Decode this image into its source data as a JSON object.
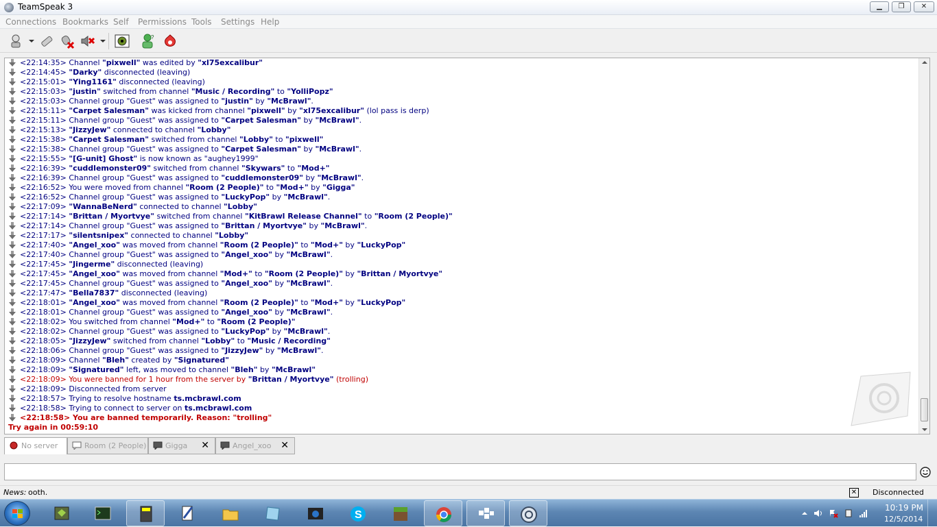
{
  "window": {
    "title": "TeamSpeak 3",
    "min": "▁",
    "max": "❐",
    "close": "✕"
  },
  "menu": [
    "Connections",
    "Bookmarks",
    "Self",
    "Permissions",
    "Tools",
    "Settings",
    "Help"
  ],
  "toolbar": {
    "icons": [
      "connect-icon",
      "disconnect-icon",
      "mute-microphone-icon",
      "mute-speakers-icon",
      "away-icon",
      "activate-microphone-icon",
      "subscribe-icon"
    ]
  },
  "log": [
    {
      "time": "<22:14:35>",
      "parts": [
        [
          "n",
          "Channel "
        ],
        [
          "b",
          "\"pixwell\""
        ],
        [
          "n",
          " was edited by "
        ],
        [
          "b",
          "\"xl75excalibur\""
        ]
      ]
    },
    {
      "time": "<22:14:45>",
      "parts": [
        [
          "b",
          "\"Darky\""
        ],
        [
          "n",
          " disconnected (leaving)"
        ]
      ]
    },
    {
      "time": "<22:15:01>",
      "parts": [
        [
          "b",
          "\"Ying1161\""
        ],
        [
          "n",
          " disconnected (leaving)"
        ]
      ]
    },
    {
      "time": "<22:15:03>",
      "parts": [
        [
          "b",
          "\"justin\""
        ],
        [
          "n",
          " switched from channel "
        ],
        [
          "b",
          "\"Music / Recording\""
        ],
        [
          "n",
          " to "
        ],
        [
          "b",
          "\"YolliPopz\""
        ]
      ]
    },
    {
      "time": "<22:15:03>",
      "parts": [
        [
          "n",
          "Channel group \"Guest\" was assigned to "
        ],
        [
          "b",
          "\"justin\""
        ],
        [
          "n",
          " by "
        ],
        [
          "b",
          "\"McBrawl\""
        ],
        [
          "n",
          "."
        ]
      ]
    },
    {
      "time": "<22:15:11>",
      "parts": [
        [
          "b",
          "\"Carpet Salesman\""
        ],
        [
          "n",
          " was kicked from channel "
        ],
        [
          "b",
          "\"pixwell\""
        ],
        [
          "n",
          " by "
        ],
        [
          "b",
          "\"xl75excalibur\""
        ],
        [
          "n",
          " (lol pass is derp)"
        ]
      ]
    },
    {
      "time": "<22:15:11>",
      "parts": [
        [
          "n",
          "Channel group \"Guest\" was assigned to "
        ],
        [
          "b",
          "\"Carpet Salesman\""
        ],
        [
          "n",
          " by "
        ],
        [
          "b",
          "\"McBrawl\""
        ],
        [
          "n",
          "."
        ]
      ]
    },
    {
      "time": "<22:15:13>",
      "parts": [
        [
          "b",
          "\"JizzyJew\""
        ],
        [
          "n",
          " connected to channel "
        ],
        [
          "b",
          "\"Lobby\""
        ]
      ]
    },
    {
      "time": "<22:15:38>",
      "parts": [
        [
          "b",
          "\"Carpet Salesman\""
        ],
        [
          "n",
          " switched from channel "
        ],
        [
          "b",
          "\"Lobby\""
        ],
        [
          "n",
          " to "
        ],
        [
          "b",
          "\"pixwell\""
        ]
      ]
    },
    {
      "time": "<22:15:38>",
      "parts": [
        [
          "n",
          "Channel group \"Guest\" was assigned to "
        ],
        [
          "b",
          "\"Carpet Salesman\""
        ],
        [
          "n",
          " by "
        ],
        [
          "b",
          "\"McBrawl\""
        ],
        [
          "n",
          "."
        ]
      ]
    },
    {
      "time": "<22:15:55>",
      "parts": [
        [
          "b",
          "\"[G-unit] Ghost\""
        ],
        [
          "n",
          " is now known as \"aughey1999\""
        ]
      ]
    },
    {
      "time": "<22:16:39>",
      "parts": [
        [
          "b",
          "\"cuddlemonster09\""
        ],
        [
          "n",
          " switched from channel "
        ],
        [
          "b",
          "\"Skywars\""
        ],
        [
          "n",
          " to "
        ],
        [
          "b",
          "\"Mod+\""
        ]
      ]
    },
    {
      "time": "<22:16:39>",
      "parts": [
        [
          "n",
          "Channel group \"Guest\" was assigned to "
        ],
        [
          "b",
          "\"cuddlemonster09\""
        ],
        [
          "n",
          " by "
        ],
        [
          "b",
          "\"McBrawl\""
        ],
        [
          "n",
          "."
        ]
      ]
    },
    {
      "time": "<22:16:52>",
      "parts": [
        [
          "n",
          "You were moved from channel "
        ],
        [
          "b",
          "\"Room (2 People)\""
        ],
        [
          "n",
          " to "
        ],
        [
          "b",
          "\"Mod+\""
        ],
        [
          "n",
          " by "
        ],
        [
          "b",
          "\"Gigga\""
        ]
      ]
    },
    {
      "time": "<22:16:52>",
      "parts": [
        [
          "n",
          "Channel group \"Guest\" was assigned to "
        ],
        [
          "b",
          "\"LuckyPop\""
        ],
        [
          "n",
          " by "
        ],
        [
          "b",
          "\"McBrawl\""
        ],
        [
          "n",
          "."
        ]
      ]
    },
    {
      "time": "<22:17:09>",
      "parts": [
        [
          "b",
          "\"WannaBeNerd\""
        ],
        [
          "n",
          " connected to channel "
        ],
        [
          "b",
          "\"Lobby\""
        ]
      ]
    },
    {
      "time": "<22:17:14>",
      "parts": [
        [
          "b",
          "\"Brittan / Myortvye\""
        ],
        [
          "n",
          " switched from channel "
        ],
        [
          "b",
          "\"KitBrawl Release Channel\""
        ],
        [
          "n",
          " to "
        ],
        [
          "b",
          "\"Room (2 People)\""
        ]
      ]
    },
    {
      "time": "<22:17:14>",
      "parts": [
        [
          "n",
          "Channel group \"Guest\" was assigned to "
        ],
        [
          "b",
          "\"Brittan / Myortvye\""
        ],
        [
          "n",
          " by "
        ],
        [
          "b",
          "\"McBrawl\""
        ],
        [
          "n",
          "."
        ]
      ]
    },
    {
      "time": "<22:17:17>",
      "parts": [
        [
          "b",
          "\"silentsnipex\""
        ],
        [
          "n",
          " connected to channel "
        ],
        [
          "b",
          "\"Lobby\""
        ]
      ]
    },
    {
      "time": "<22:17:40>",
      "parts": [
        [
          "b",
          "\"Angel_xoo\""
        ],
        [
          "n",
          " was moved from channel "
        ],
        [
          "b",
          "\"Room (2 People)\""
        ],
        [
          "n",
          " to "
        ],
        [
          "b",
          "\"Mod+\""
        ],
        [
          "n",
          " by "
        ],
        [
          "b",
          "\"LuckyPop\""
        ]
      ]
    },
    {
      "time": "<22:17:40>",
      "parts": [
        [
          "n",
          "Channel group \"Guest\" was assigned to "
        ],
        [
          "b",
          "\"Angel_xoo\""
        ],
        [
          "n",
          " by "
        ],
        [
          "b",
          "\"McBrawl\""
        ],
        [
          "n",
          "."
        ]
      ]
    },
    {
      "time": "<22:17:45>",
      "parts": [
        [
          "b",
          "\"Jingerme\""
        ],
        [
          "n",
          " disconnected (leaving)"
        ]
      ]
    },
    {
      "time": "<22:17:45>",
      "parts": [
        [
          "b",
          "\"Angel_xoo\""
        ],
        [
          "n",
          " was moved from channel "
        ],
        [
          "b",
          "\"Mod+\""
        ],
        [
          "n",
          " to "
        ],
        [
          "b",
          "\"Room (2 People)\""
        ],
        [
          "n",
          " by "
        ],
        [
          "b",
          "\"Brittan / Myortvye\""
        ]
      ]
    },
    {
      "time": "<22:17:45>",
      "parts": [
        [
          "n",
          "Channel group \"Guest\" was assigned to "
        ],
        [
          "b",
          "\"Angel_xoo\""
        ],
        [
          "n",
          " by "
        ],
        [
          "b",
          "\"McBrawl\""
        ],
        [
          "n",
          "."
        ]
      ]
    },
    {
      "time": "<22:17:47>",
      "parts": [
        [
          "b",
          "\"Bella7837\""
        ],
        [
          "n",
          " disconnected (leaving)"
        ]
      ]
    },
    {
      "time": "<22:18:01>",
      "parts": [
        [
          "b",
          "\"Angel_xoo\""
        ],
        [
          "n",
          " was moved from channel "
        ],
        [
          "b",
          "\"Room (2 People)\""
        ],
        [
          "n",
          " to "
        ],
        [
          "b",
          "\"Mod+\""
        ],
        [
          "n",
          " by "
        ],
        [
          "b",
          "\"LuckyPop\""
        ]
      ]
    },
    {
      "time": "<22:18:01>",
      "parts": [
        [
          "n",
          "Channel group \"Guest\" was assigned to "
        ],
        [
          "b",
          "\"Angel_xoo\""
        ],
        [
          "n",
          " by "
        ],
        [
          "b",
          "\"McBrawl\""
        ],
        [
          "n",
          "."
        ]
      ]
    },
    {
      "time": "<22:18:02>",
      "parts": [
        [
          "n",
          "You switched from channel "
        ],
        [
          "b",
          "\"Mod+\""
        ],
        [
          "n",
          " to "
        ],
        [
          "b",
          "\"Room (2 People)\""
        ]
      ]
    },
    {
      "time": "<22:18:02>",
      "parts": [
        [
          "n",
          "Channel group \"Guest\" was assigned to "
        ],
        [
          "b",
          "\"LuckyPop\""
        ],
        [
          "n",
          " by "
        ],
        [
          "b",
          "\"McBrawl\""
        ],
        [
          "n",
          "."
        ]
      ]
    },
    {
      "time": "<22:18:05>",
      "parts": [
        [
          "b",
          "\"JizzyJew\""
        ],
        [
          "n",
          " switched from channel "
        ],
        [
          "b",
          "\"Lobby\""
        ],
        [
          "n",
          " to "
        ],
        [
          "b",
          "\"Music / Recording\""
        ]
      ]
    },
    {
      "time": "<22:18:06>",
      "parts": [
        [
          "n",
          "Channel group \"Guest\" was assigned to "
        ],
        [
          "b",
          "\"JizzyJew\""
        ],
        [
          "n",
          " by "
        ],
        [
          "b",
          "\"McBrawl\""
        ],
        [
          "n",
          "."
        ]
      ]
    },
    {
      "time": "<22:18:09>",
      "parts": [
        [
          "n",
          "Channel "
        ],
        [
          "b",
          "\"Bleh\""
        ],
        [
          "n",
          " created by "
        ],
        [
          "b",
          "\"Signatured\""
        ]
      ]
    },
    {
      "time": "<22:18:09>",
      "parts": [
        [
          "b",
          "\"Signatured\""
        ],
        [
          "n",
          " left, was moved to channel "
        ],
        [
          "b",
          "\"Bleh\""
        ],
        [
          "n",
          " by "
        ],
        [
          "b",
          "\"McBrawl\""
        ]
      ]
    },
    {
      "time": "<22:18:09>",
      "style": "red",
      "parts": [
        [
          "n",
          "You were banned for 1 hour from the server by "
        ],
        [
          "bb",
          "\"Brittan / Myortvye\""
        ],
        [
          "n",
          " (trolling)"
        ]
      ]
    },
    {
      "time": "<22:18:09>",
      "parts": [
        [
          "n",
          "Disconnected from server"
        ]
      ]
    },
    {
      "time": "<22:18:57>",
      "parts": [
        [
          "n",
          "Trying to resolve hostname "
        ],
        [
          "b",
          "ts.mcbrawl.com"
        ]
      ]
    },
    {
      "time": "<22:18:58>",
      "parts": [
        [
          "n",
          "Trying to connect to server on "
        ],
        [
          "b",
          "ts.mcbrawl.com"
        ]
      ]
    },
    {
      "time": "<22:18:58>",
      "style": "redbold",
      "parts": [
        [
          "n",
          "You are banned temporarily. Reason: \"trolling\""
        ]
      ]
    }
  ],
  "try_again": "Try again in 00:59:10",
  "tabs": [
    {
      "label": "No server",
      "active": true,
      "closable": false,
      "icon": "server-icon"
    },
    {
      "label": "Room (2 People)",
      "active": false,
      "closable": false,
      "icon": "chat-icon"
    },
    {
      "label": "Gigga",
      "active": false,
      "closable": true,
      "icon": "chat-icon"
    },
    {
      "label": "Angel_xoo",
      "active": false,
      "closable": true,
      "icon": "chat-icon"
    }
  ],
  "chat_input": {
    "value": "",
    "placeholder": ""
  },
  "status": {
    "news_label": "News:",
    "news_text": "ooth.",
    "close": "✕",
    "connection": "Disconnected"
  },
  "taskbar": {
    "apps": [
      "vmware-icon",
      "terminal-icon",
      "calculator-icon",
      "notepad-icon",
      "explorer-icon",
      "notes-icon",
      "media-icon",
      "skype-icon",
      "minecraft-icon",
      "chrome-icon",
      "app-icon",
      "teamspeak-icon"
    ],
    "time": "10:19 PM",
    "date": "12/5/2014"
  }
}
